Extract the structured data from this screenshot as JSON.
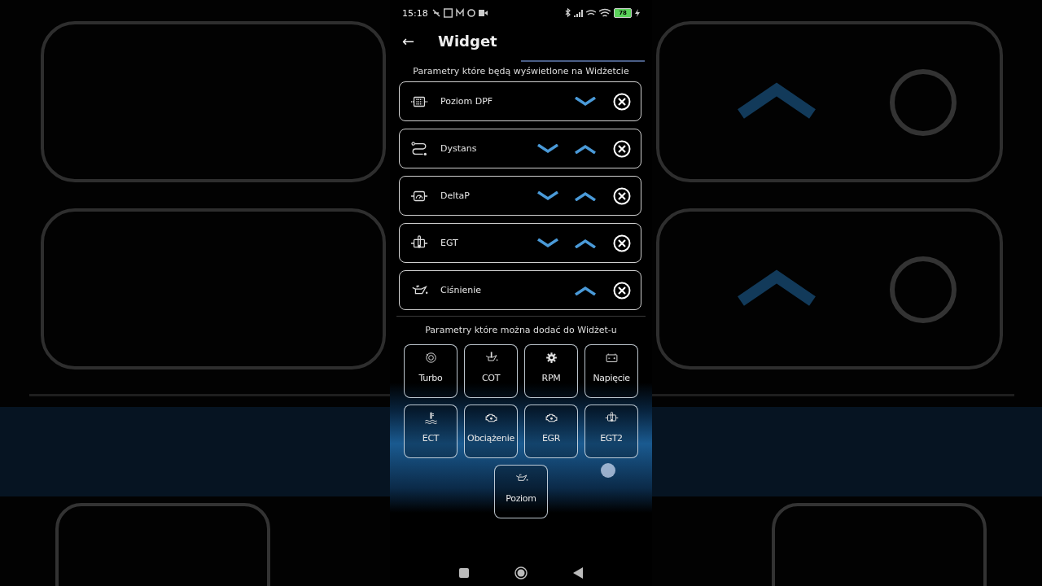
{
  "status_bar": {
    "time": "15:18",
    "battery": "78"
  },
  "header": {
    "back": "←",
    "title": "Widget"
  },
  "widget_section": {
    "title": "Parametry które będą wyświetlone na Widżetcie",
    "items": [
      {
        "label": "Poziom DPF",
        "move_down": true,
        "move_up": false
      },
      {
        "label": "Dystans",
        "move_down": true,
        "move_up": true
      },
      {
        "label": "DeltaP",
        "move_down": true,
        "move_up": true
      },
      {
        "label": "EGT",
        "move_down": true,
        "move_up": true
      },
      {
        "label": "Ciśnienie",
        "move_down": false,
        "move_up": true
      }
    ]
  },
  "available_section": {
    "title": "Parametry które można dodać do Widżet-u",
    "tiles": [
      {
        "label": "Turbo"
      },
      {
        "label": "COT"
      },
      {
        "label": "RPM"
      },
      {
        "label": "Napięcie"
      },
      {
        "label": "ECT"
      },
      {
        "label": "Obciążenie"
      },
      {
        "label": "EGR"
      },
      {
        "label": "EGT2"
      },
      {
        "label": "Poziom"
      }
    ]
  }
}
